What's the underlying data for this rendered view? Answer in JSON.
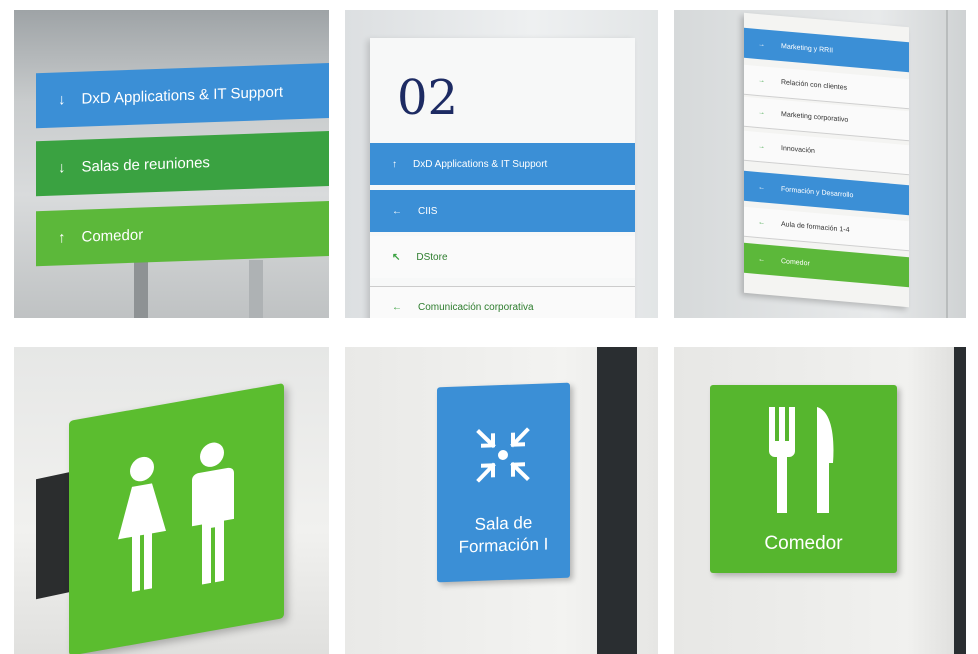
{
  "tiles": [
    {
      "stripes": [
        {
          "arrow": "↓",
          "label": "DxD Applications & IT Support",
          "color": "#3b8fd6"
        },
        {
          "arrow": "↓",
          "label": "Salas de reuniones",
          "color": "#3aa241"
        },
        {
          "arrow": "↑",
          "label": "Comedor",
          "color": "#5cb83a"
        }
      ]
    },
    {
      "floor_number": "02",
      "stripes": [
        {
          "arrow": "↑",
          "label": "DxD Applications & IT Support",
          "color": "#3b8fd6"
        },
        {
          "arrow": "←",
          "label": "CIIS",
          "color": "#3b8fd6"
        },
        {
          "arrow": "↖",
          "label": "DStore",
          "color": "#fafafa"
        },
        {
          "arrow": "←",
          "label": "Comunicación corporativa",
          "color": "#fafafa"
        }
      ]
    },
    {
      "stripes": [
        {
          "arrow": "→",
          "label": "Marketing y RRII",
          "color": "#3b8fd6"
        },
        {
          "arrow": "→",
          "label": "Relación con clientes",
          "color": "#fafafa"
        },
        {
          "arrow": "→",
          "label": "Marketing corporativo",
          "color": "#fafafa"
        },
        {
          "arrow": "→",
          "label": "Innovación",
          "color": "#fafafa"
        },
        {
          "arrow": "←",
          "label": "Formación y Desarrollo",
          "color": "#3b8fd6"
        },
        {
          "arrow": "←",
          "label": "Aula de formación 1-4",
          "color": "#fafafa"
        },
        {
          "arrow": "←",
          "label": "Comedor",
          "color": "#5cb83a"
        }
      ]
    },
    {
      "icon": "restroom-icon"
    },
    {
      "icon": "meeting-point-icon",
      "label_line1": "Sala de",
      "label_line2": "Formación I"
    },
    {
      "icon": "fork-knife-icon",
      "label": "Comedor"
    }
  ]
}
